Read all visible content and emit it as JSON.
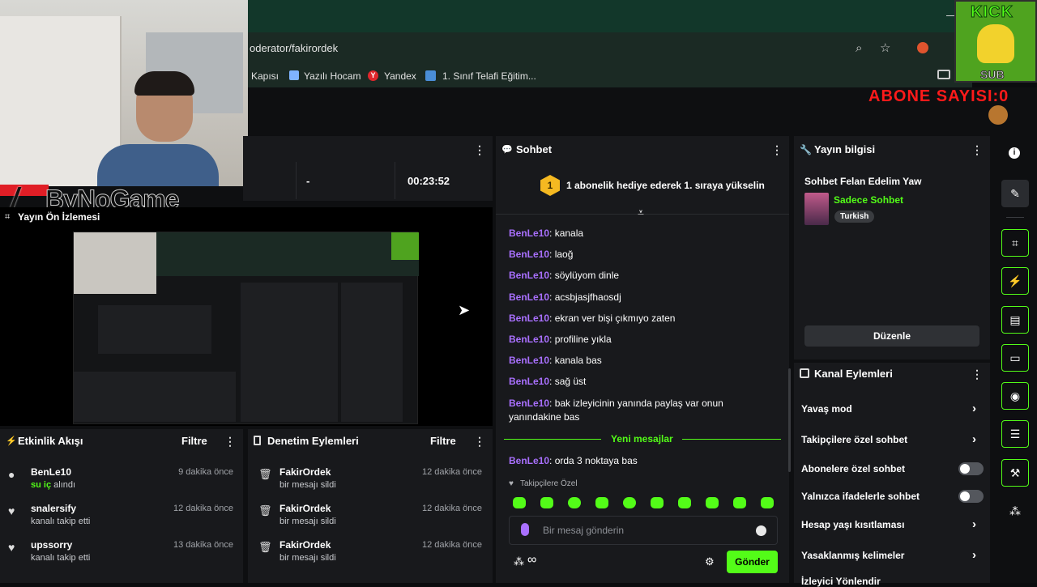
{
  "browser": {
    "address": "oderator/fakirordek",
    "bookmarks": [
      "Kapısı",
      "Yazılı Hocam",
      "Yandex",
      "1. Sınıf Telafi Eğitim..."
    ]
  },
  "overlay": {
    "brand": "ByNoGame",
    "kick_logo": "KICK",
    "sub_label": "SUB",
    "abone": "ABONE SAYISI:0"
  },
  "stats": {
    "dash": "-",
    "time": "00:23:52"
  },
  "preview": {
    "title": "Yayın Ön İzlemesi"
  },
  "activity": {
    "title": "Etkinlik Akışı",
    "filter": "Filtre",
    "items": [
      {
        "name": "BenLe10",
        "highlight": "su iç",
        "desc": "alındı",
        "time": "9 dakika önce"
      },
      {
        "name": "snalersify",
        "desc": "kanalı takip etti",
        "time": "12 dakika önce"
      },
      {
        "name": "upssorry",
        "desc": "kanalı takip etti",
        "time": "13 dakika önce"
      }
    ]
  },
  "moderation_log": {
    "title": "Denetim Eylemleri",
    "filter": "Filtre",
    "items": [
      {
        "name": "FakirOrdek",
        "desc": "bir mesajı sildi",
        "time": "12 dakika önce"
      },
      {
        "name": "FakirOrdek",
        "desc": "bir mesajı sildi",
        "time": "12 dakika önce"
      },
      {
        "name": "FakirOrdek",
        "desc": "bir mesajı sildi",
        "time": "12 dakika önce"
      }
    ]
  },
  "chat": {
    "title": "Sohbet",
    "gift_badge": "1",
    "gift_text": "1 abonelik hediye ederek 1. sıraya yükselin",
    "messages": [
      {
        "user": "BenLe10",
        "text": ": kanala"
      },
      {
        "user": "BenLe10",
        "text": ": laoğ"
      },
      {
        "user": "BenLe10",
        "text": ": söylüyom dinle"
      },
      {
        "user": "BenLe10",
        "text": ": acsbjasjfhaosdj"
      },
      {
        "user": "BenLe10",
        "text": ": ekran ver bişi çıkmıyo zaten"
      },
      {
        "user": "BenLe10",
        "text": ": profiline yıkla"
      },
      {
        "user": "BenLe10",
        "text": ": kanala bas"
      },
      {
        "user": "BenLe10",
        "text": ": sağ üst"
      },
      {
        "user": "BenLe10",
        "text": ": bak izleyicinin yanında paylaş var onun yanındakine bas"
      }
    ],
    "new_messages": "Yeni mesajlar",
    "last_message": {
      "user": "BenLe10",
      "text": ": orda 3 noktaya bas"
    },
    "followers_only": "Takipçilere Özel",
    "input_placeholder": "Bir mesaj gönderin",
    "send": "Gönder"
  },
  "stream_info": {
    "title": "Yayın bilgisi",
    "stream_title": "Sohbet Felan Edelim Yaw",
    "category": "Sadece Sohbet",
    "tag": "Turkish",
    "edit": "Düzenle"
  },
  "channel_actions": {
    "title": "Kanal Eylemleri",
    "rows": [
      {
        "label": "Yavaş mod",
        "type": "chevron"
      },
      {
        "label": "Takipçilere özel sohbet",
        "type": "chevron"
      },
      {
        "label": "Abonelere özel sohbet",
        "type": "toggle"
      },
      {
        "label": "Yalnızca ifadelerle sohbet",
        "type": "toggle"
      },
      {
        "label": "Hesap yaşı kısıtlaması",
        "type": "chevron"
      },
      {
        "label": "Yasaklanmış kelimeler",
        "type": "chevron"
      },
      {
        "label": "İzleyici Yönlendir",
        "type": "chevron"
      }
    ]
  },
  "colors": {
    "accent": "#53fc18",
    "username": "#a970ff",
    "alert": "#ff1a1a"
  }
}
